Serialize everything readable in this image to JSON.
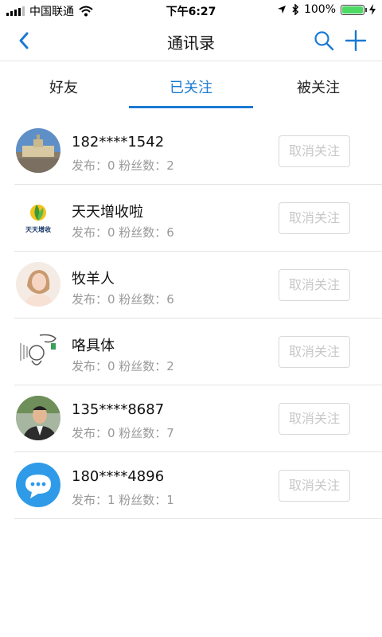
{
  "status_bar": {
    "carrier": "中国联通",
    "time": "下午6:27",
    "battery": "100%"
  },
  "nav": {
    "title": "通讯录"
  },
  "tabs": [
    {
      "label": "好友",
      "active": false
    },
    {
      "label": "已关注",
      "active": true
    },
    {
      "label": "被关注",
      "active": false
    }
  ],
  "contacts": [
    {
      "name": "182****1542",
      "stats": "发布：0  粉丝数：2",
      "button": "取消关注",
      "avatar_icon": "building-photo-icon"
    },
    {
      "name": "天天增收啦",
      "stats": "发布：0  粉丝数：6",
      "button": "取消关注",
      "avatar_icon": "leaf-logo-icon",
      "avatar_text": "天天增收"
    },
    {
      "name": "牧羊人",
      "stats": "发布：0  粉丝数：6",
      "button": "取消关注",
      "avatar_icon": "woman-photo-icon"
    },
    {
      "name": "咯具体",
      "stats": "发布：0  粉丝数：2",
      "button": "取消关注",
      "avatar_icon": "cartoon-sketch-icon"
    },
    {
      "name": "135****8687",
      "stats": "发布：0  粉丝数：7",
      "button": "取消关注",
      "avatar_icon": "man-photo-icon"
    },
    {
      "name": "180****4896",
      "stats": "发布：1  粉丝数：1",
      "button": "取消关注",
      "avatar_icon": "chat-bubble-icon"
    }
  ],
  "colors": {
    "accent": "#1a7ad4",
    "divider": "#e3e3e3",
    "muted": "#999999"
  }
}
